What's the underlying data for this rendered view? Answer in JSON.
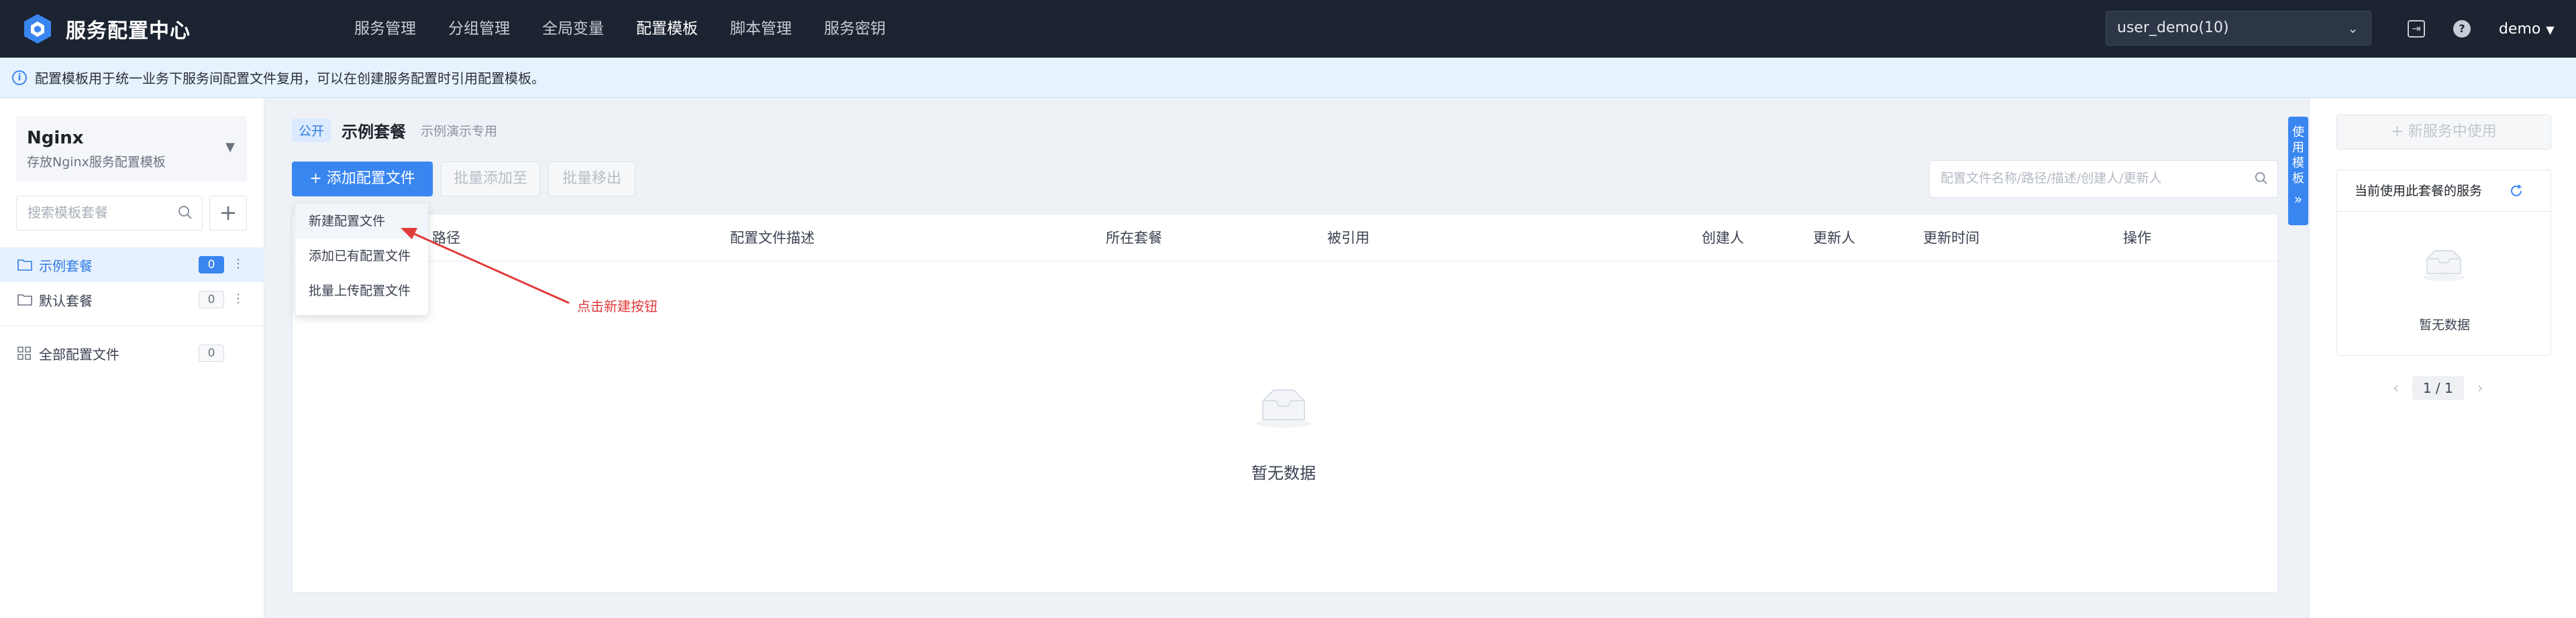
{
  "app": {
    "title": "服务配置中心"
  },
  "nav": {
    "items": [
      "服务管理",
      "分组管理",
      "全局变量",
      "配置模板",
      "脚本管理",
      "服务密钥"
    ],
    "active": "配置模板"
  },
  "header": {
    "user_select": "user_demo(10)",
    "user_name": "demo",
    "help_glyph": "?",
    "export_icon": "export-icon"
  },
  "info": {
    "text": "配置模板用于统一业务下服务间配置文件复用，可以在创建服务配置时引用配置模板。"
  },
  "sidebar": {
    "suite_name": "Nginx",
    "suite_desc": "存放Nginx服务配置模板",
    "search_placeholder": "搜索模板套餐",
    "items": [
      {
        "label": "示例套餐",
        "count": "0",
        "active": true
      },
      {
        "label": "默认套餐",
        "count": "0",
        "active": false
      }
    ],
    "all_files": {
      "label": "全部配置文件",
      "count": "0"
    }
  },
  "content": {
    "tag": "公开",
    "title": "示例套餐",
    "subtitle": "示例演示专用",
    "add_button": "+ 添加配置文件",
    "batch_add_button": "批量添加至",
    "batch_remove_button": "批量移出",
    "search_placeholder": "配置文件名称/路径/描述/创建人/更新人",
    "columns": [
      "路径",
      "配置文件描述",
      "所在套餐",
      "被引用",
      "创建人",
      "更新人",
      "更新时间",
      "操作"
    ],
    "empty_text": "暂无数据",
    "dropdown": [
      "新建配置文件",
      "添加已有配置文件",
      "批量上传配置文件"
    ],
    "annotation": "点击新建按钮"
  },
  "side_tab": {
    "label": "使用模板",
    "glyph": "»"
  },
  "right_panel": {
    "new_service_button": "+ 新服务中使用",
    "card_title": "当前使用此套餐的服务",
    "empty_text": "暂无数据",
    "pager": {
      "prev": "‹",
      "page": "1 / 1",
      "next": "›"
    }
  },
  "colors": {
    "topbar": "#1c2431",
    "primary": "#3a86f0",
    "annotation": "#e23b3b",
    "info_bg": "#e6f2fe"
  }
}
